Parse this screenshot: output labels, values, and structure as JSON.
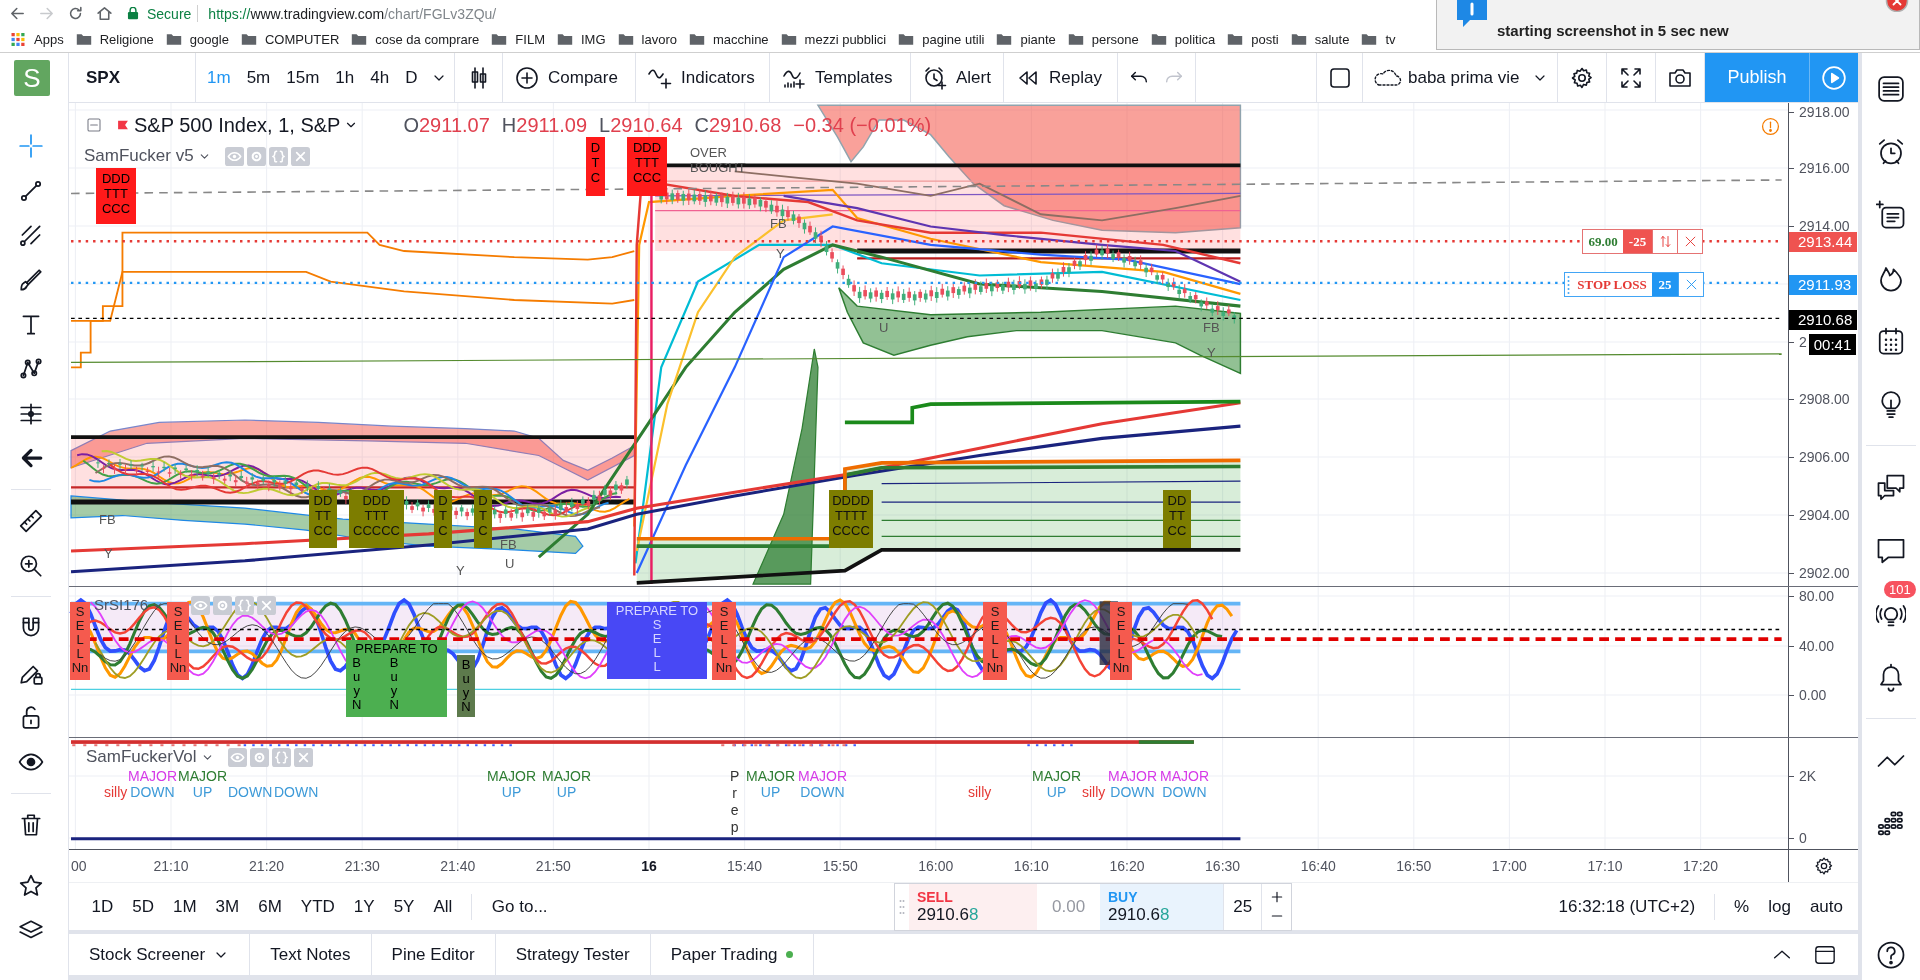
{
  "browser": {
    "nav": [
      {
        "disabled": false
      },
      {
        "disabled": true
      },
      {
        "disabled": false
      },
      {
        "disabled": false
      }
    ],
    "secure_label": "Secure",
    "url": {
      "scheme": "https://",
      "host": "www.tradingview.com",
      "path": "/chart/FGLv3ZQu/"
    },
    "bookmarks": [
      {
        "kind": "apps",
        "label": "Apps"
      },
      {
        "kind": "folder",
        "label": "Religione"
      },
      {
        "kind": "folder",
        "label": "google"
      },
      {
        "kind": "folder",
        "label": "COMPUTER"
      },
      {
        "kind": "folder",
        "label": "cose da comprare"
      },
      {
        "kind": "folder",
        "label": "FILM"
      },
      {
        "kind": "folder",
        "label": "IMG"
      },
      {
        "kind": "folder",
        "label": "lavoro"
      },
      {
        "kind": "folder",
        "label": "macchine"
      },
      {
        "kind": "folder",
        "label": "mezzi pubblici"
      },
      {
        "kind": "folder",
        "label": "pagine utili"
      },
      {
        "kind": "folder",
        "label": "piante"
      },
      {
        "kind": "folder",
        "label": "persone"
      },
      {
        "kind": "folder",
        "label": "politica"
      },
      {
        "kind": "folder",
        "label": "posti"
      },
      {
        "kind": "folder",
        "label": "salute"
      },
      {
        "kind": "folder",
        "label": "tv"
      }
    ]
  },
  "notification": {
    "message": "starting screenshot in 5 sec new"
  },
  "logo": {
    "letter": "S"
  },
  "toolbar": {
    "symbol": "SPX",
    "intervals": [
      {
        "label": "1m",
        "selected": true
      },
      {
        "label": "5m",
        "selected": false
      },
      {
        "label": "15m",
        "selected": false
      },
      {
        "label": "1h",
        "selected": false
      },
      {
        "label": "4h",
        "selected": false
      },
      {
        "label": "D",
        "selected": false
      }
    ],
    "actions": [
      "Compare",
      "Indicators",
      "Templates",
      "Alert",
      "Replay"
    ],
    "history": [
      {
        "disabled": false
      },
      {
        "disabled": true
      }
    ],
    "layout_name": "baba prima vie",
    "publish": "Publish"
  },
  "drawing_tools": [
    {
      "selected": true
    },
    {
      "selected": false
    },
    {
      "selected": false
    },
    {
      "selected": false
    },
    {
      "selected": false
    },
    {
      "selected": false
    },
    {
      "selected": false
    },
    {
      "selected": false
    }
  ],
  "right_sidebar": {
    "signals_badge": "101"
  },
  "chart": {
    "legend": {
      "title": "S&P 500 Index, 1, S&P",
      "ohlc": [
        {
          "key": "O",
          "value": "2911.07"
        },
        {
          "key": "H",
          "value": "2911.09"
        },
        {
          "key": "L",
          "value": "2910.64"
        },
        {
          "key": "C",
          "value": "2910.68"
        }
      ],
      "change": "−0.34 (−0.01%)"
    },
    "panes": [
      {
        "kind": "price",
        "study": "SamFucker v5",
        "ticks": [
          "2918.00",
          "2916.00",
          "2914.00",
          "2",
          "2908.00",
          "2906.00",
          "2904.00",
          "2902.00"
        ],
        "price_labels": [
          {
            "value": "2913.44",
            "color": "#ef5350"
          },
          {
            "value": "2911.93",
            "color": "#2196f3"
          },
          {
            "value": "2910.68",
            "color": "#000000"
          }
        ],
        "countdown": "00:41",
        "orders": [
          {
            "kind": "take_profit",
            "price": "69.00",
            "quantity": "-25"
          },
          {
            "kind": "stop_loss",
            "label": "STOP LOSS",
            "quantity": "25"
          }
        ],
        "markers": [
          {
            "kind": "top_signal",
            "lines": [
              "DDD",
              "TTT",
              "CCC"
            ]
          },
          {
            "kind": "note",
            "lines": [
              "FB"
            ]
          },
          {
            "kind": "note",
            "lines": [
              "Y"
            ]
          },
          {
            "kind": "bottom_signal",
            "lines": [
              "DD",
              "TT",
              "CC"
            ]
          },
          {
            "kind": "bottom_signal",
            "lines": [
              "DDD",
              "TTT",
              "CCCCC"
            ]
          },
          {
            "kind": "bottom_signal",
            "lines": [
              "D",
              "T",
              "C"
            ]
          },
          {
            "kind": "note",
            "lines": [
              "Y"
            ]
          },
          {
            "kind": "bottom_signal",
            "lines": [
              "D",
              "T",
              "C"
            ]
          },
          {
            "kind": "note",
            "lines": [
              "FB"
            ]
          },
          {
            "kind": "note",
            "lines": [
              "U"
            ]
          },
          {
            "kind": "top_signal",
            "lines": [
              "D",
              "T",
              "C"
            ]
          },
          {
            "kind": "top_signal",
            "lines": [
              "DDD",
              "TTT",
              "CCC"
            ]
          },
          {
            "kind": "note",
            "lines": [
              "OVER",
              "BOUGHT"
            ]
          },
          {
            "kind": "note",
            "lines": [
              "FB"
            ]
          },
          {
            "kind": "note",
            "lines": [
              "Y"
            ]
          },
          {
            "kind": "bottom_signal",
            "lines": [
              "DDDD",
              "TTTT",
              "CCCC"
            ]
          },
          {
            "kind": "note",
            "lines": [
              "U"
            ]
          },
          {
            "kind": "bottom_signal",
            "lines": [
              "DD",
              "TT",
              "CC"
            ]
          },
          {
            "kind": "note",
            "lines": [
              "FB"
            ]
          },
          {
            "kind": "note",
            "lines": [
              "Y"
            ]
          }
        ]
      },
      {
        "kind": "oscillator",
        "study": "SrSI176",
        "ticks": [
          "80.00",
          "40.00",
          "0.00"
        ],
        "markers": [
          {
            "kind": "sell",
            "lines": [
              "S",
              "E",
              "L",
              "L",
              "Nn"
            ]
          },
          {
            "kind": "sell",
            "lines": [
              "S",
              "E",
              "L",
              "L",
              "Nn"
            ]
          },
          {
            "kind": "prepare_buy",
            "title": "PREPARE TO",
            "columns": [
              [
                "B",
                "u",
                "y",
                "N"
              ],
              [
                "B",
                "u",
                "y",
                "N"
              ]
            ]
          },
          {
            "kind": "buy",
            "lines": [
              "B",
              "u",
              "y",
              "N"
            ]
          },
          {
            "kind": "prepare_sell",
            "title": "PREPARE TO",
            "columns": [
              [
                "S",
                "E",
                "L",
                "L"
              ]
            ]
          },
          {
            "kind": "sell",
            "lines": [
              "S",
              "E",
              "L",
              "L",
              "Nn"
            ]
          },
          {
            "kind": "sell",
            "lines": [
              "S",
              "E",
              "L",
              "L",
              "Nn"
            ]
          },
          {
            "kind": "sell",
            "lines": [
              "S",
              "E",
              "L",
              "L",
              "Nn"
            ]
          }
        ]
      },
      {
        "kind": "volume",
        "study": "SamFuckerVol",
        "ticks": [
          "2K",
          "0"
        ],
        "markers": [
          {
            "kind": "silly",
            "lines": [
              "silly"
            ]
          },
          {
            "kind": "major_down",
            "lines": [
              "MAJOR",
              "DOWN"
            ]
          },
          {
            "kind": "major_up",
            "lines": [
              "MAJOR",
              "UP"
            ]
          },
          {
            "kind": "down",
            "lines": [
              "DOWN"
            ]
          },
          {
            "kind": "down",
            "lines": [
              "DOWN"
            ]
          },
          {
            "kind": "major_up",
            "lines": [
              "MAJOR",
              "UP"
            ]
          },
          {
            "kind": "major_up",
            "lines": [
              "MAJOR",
              "UP"
            ]
          },
          {
            "kind": "prep",
            "lines": [
              "P",
              "r",
              "e",
              "p"
            ]
          },
          {
            "kind": "major_up",
            "lines": [
              "MAJOR",
              "UP"
            ]
          },
          {
            "kind": "major_down",
            "lines": [
              "MAJOR",
              "DOWN"
            ]
          },
          {
            "kind": "silly",
            "lines": [
              "silly"
            ]
          },
          {
            "kind": "major_up",
            "lines": [
              "MAJOR",
              "UP"
            ]
          },
          {
            "kind": "silly",
            "lines": [
              "silly"
            ]
          },
          {
            "kind": "major_down",
            "lines": [
              "MAJOR",
              "DOWN"
            ]
          },
          {
            "kind": "major_down",
            "lines": [
              "MAJOR",
              "DOWN"
            ]
          }
        ]
      }
    ],
    "time_axis": [
      {
        "label": "00",
        "kind": "time"
      },
      {
        "label": "21:10",
        "kind": "time"
      },
      {
        "label": "21:20",
        "kind": "time"
      },
      {
        "label": "21:30",
        "kind": "time"
      },
      {
        "label": "21:40",
        "kind": "time"
      },
      {
        "label": "21:50",
        "kind": "time"
      },
      {
        "label": "16",
        "kind": "day"
      },
      {
        "label": "15:40",
        "kind": "time"
      },
      {
        "label": "15:50",
        "kind": "time"
      },
      {
        "label": "16:00",
        "kind": "time"
      },
      {
        "label": "16:10",
        "kind": "time"
      },
      {
        "label": "16:20",
        "kind": "time"
      },
      {
        "label": "16:30",
        "kind": "time"
      },
      {
        "label": "16:40",
        "kind": "time"
      },
      {
        "label": "16:50",
        "kind": "time"
      },
      {
        "label": "17:00",
        "kind": "time"
      },
      {
        "label": "17:10",
        "kind": "time"
      },
      {
        "label": "17:20",
        "kind": "time"
      }
    ]
  },
  "bottom_toolbar": {
    "ranges": [
      "1D",
      "5D",
      "1M",
      "3M",
      "6M",
      "YTD",
      "1Y",
      "5Y",
      "All"
    ],
    "goto": "Go to...",
    "trade": {
      "sell_label": "SELL",
      "sell_price": "2910.6",
      "sell_price_tick": "8",
      "spread": "0.00",
      "buy_label": "BUY",
      "buy_price": "2910.6",
      "buy_price_tick": "8",
      "quantity": "25"
    },
    "clock": "16:32:18 (UTC+2)",
    "scale_options": [
      "%",
      "log",
      "auto"
    ]
  },
  "bottom_tabs": [
    {
      "label": "Stock Screener",
      "kind": "menu"
    },
    {
      "label": "Text Notes",
      "kind": "tab"
    },
    {
      "label": "Pine Editor",
      "kind": "tab"
    },
    {
      "label": "Strategy Tester",
      "kind": "tab"
    },
    {
      "label": "Paper Trading",
      "kind": "status"
    }
  ]
}
